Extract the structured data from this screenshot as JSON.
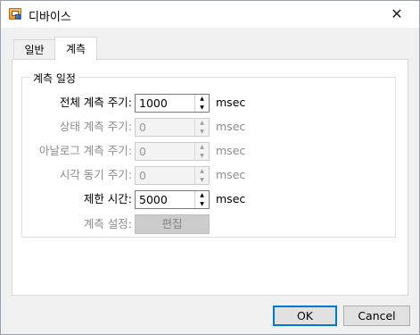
{
  "window": {
    "title": "디바이스",
    "close_glyph": "✕"
  },
  "tabs": [
    {
      "label": "일반",
      "selected": false
    },
    {
      "label": "계측",
      "selected": true
    }
  ],
  "group": {
    "title": "계측 일정",
    "rows": [
      {
        "label": "전체 계측 주기:",
        "value": "1000",
        "unit": "msec",
        "enabled": true
      },
      {
        "label": "상태 계측 주기:",
        "value": "0",
        "unit": "msec",
        "enabled": false
      },
      {
        "label": "아날로그 계측 주기:",
        "value": "0",
        "unit": "msec",
        "enabled": false
      },
      {
        "label": "시각 동기 주기:",
        "value": "0",
        "unit": "msec",
        "enabled": false
      },
      {
        "label": "제한 시간:",
        "value": "5000",
        "unit": "msec",
        "enabled": true
      }
    ],
    "setting_label": "계측 설정:",
    "edit_button_label": "편집",
    "spin_up_glyph": "▲",
    "spin_down_glyph": "▼"
  },
  "buttons": {
    "ok": "OK",
    "cancel": "Cancel"
  },
  "colors": {
    "focus_border": "#0078d7",
    "disabled_text": "#8d8d8d"
  }
}
